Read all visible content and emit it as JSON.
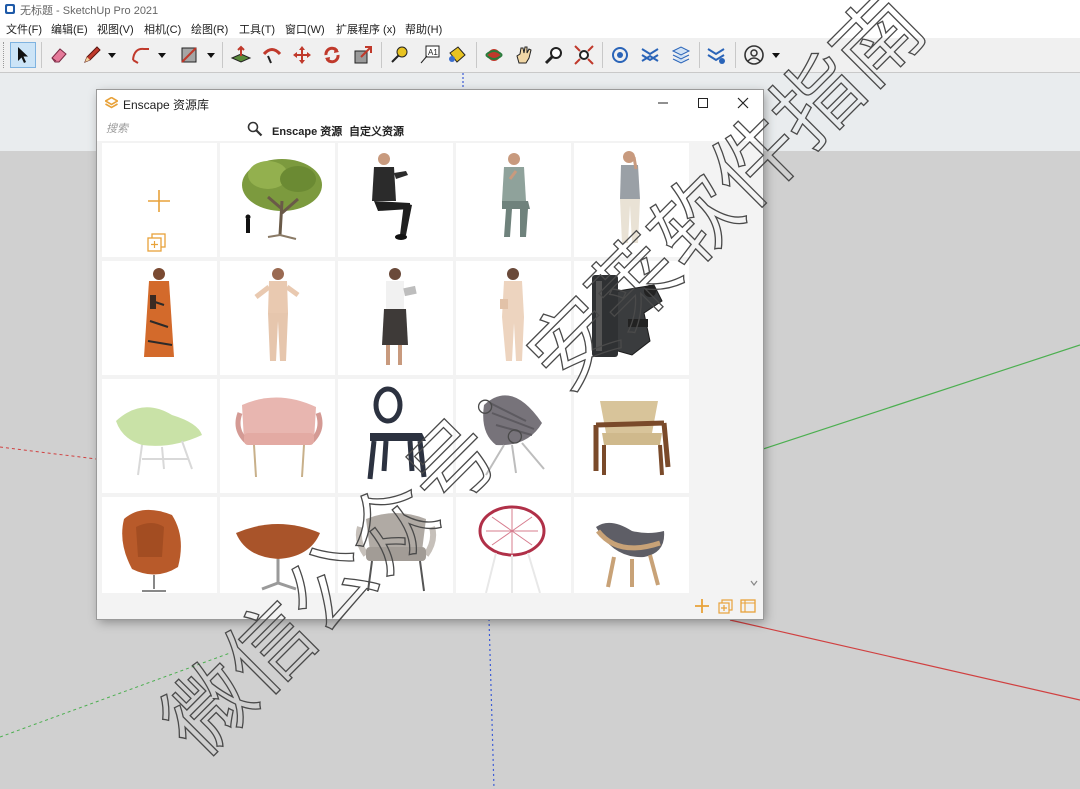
{
  "window": {
    "title": "无标题 - SketchUp Pro 2021"
  },
  "menu": [
    "文件(F)",
    "编辑(E)",
    "视图(V)",
    "相机(C)",
    "绘图(R)",
    "工具(T)",
    "窗口(W)",
    "扩展程序 (x)",
    "帮助(H)"
  ],
  "toolbar": {
    "buttons": [
      "select-icon",
      "eraser-icon",
      "pencil-icon",
      "arc-icon",
      "rectangle-icon",
      "push-pull-icon",
      "follow-me-icon",
      "move-icon",
      "rotate-icon",
      "scale-icon",
      "tape-measure-icon",
      "text-icon",
      "paint-bucket-icon",
      "orbit-icon",
      "pan-icon",
      "zoom-icon",
      "zoom-extents-icon",
      "warehouse-icon",
      "extension-icon",
      "components-icon",
      "sandbox-icon",
      "account-icon"
    ],
    "text_tool_glyph": "A1"
  },
  "dialog": {
    "title": "Enscape 资源库",
    "search": {
      "placeholder": "搜索",
      "value": ""
    },
    "tabs": {
      "enscape": "Enscape 资源",
      "custom": "自定义资源"
    },
    "active_tab": "custom",
    "assets": [
      "add-asset-tile",
      "tree-with-silhouette",
      "man-seated-black-suit",
      "man-seated-grey-suit",
      "man-standing-glasses",
      "woman-orange-dress",
      "woman-beige-suit",
      "woman-apron-tablet",
      "woman-beige-suit-2",
      "gym-machine",
      "green-lounge-chair",
      "pink-armchair",
      "ghost-chair-dark",
      "grey-knit-chair",
      "wooden-armchair",
      "egg-chair-brown",
      "brown-ottoman",
      "grey-armchair",
      "red-wire-chair",
      "shell-chair-grey"
    ]
  },
  "watermark": "微信公众号：安莱软件指南",
  "colors": {
    "accent": "#e8a23a",
    "axis_green": "#4caf50",
    "axis_red": "#d04040",
    "axis_blue": "#3b5bd6",
    "ground": "#d0d0d0",
    "sky": "#e9ecee"
  }
}
